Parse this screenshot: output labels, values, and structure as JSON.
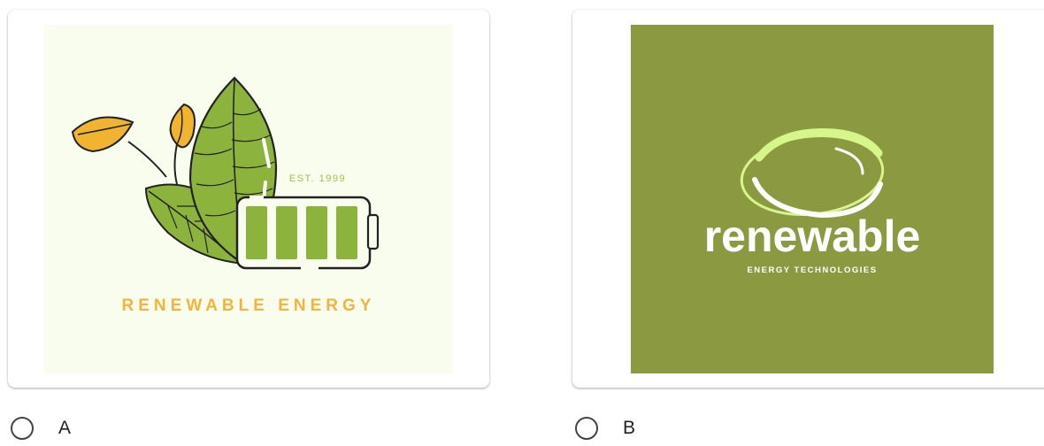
{
  "options": [
    {
      "label": "A",
      "logo": {
        "est_text": "EST. 1999",
        "brand_text": "RENEWABLE ENERGY",
        "colors": {
          "background": "#f8fdee",
          "leaf_green": "#8cb43c",
          "leaf_yellow": "#f0b431",
          "brand": "#f3b33d",
          "battery_cell": "#8cb43c",
          "est": "#9cc24e"
        },
        "battery_level": 1.0
      }
    },
    {
      "label": "B",
      "logo": {
        "brand_text": "renewable",
        "tagline": "ENERGY TECHNOLOGIES",
        "colors": {
          "background": "#8b9a40",
          "ring": "#d6f58a",
          "text": "#ffffff"
        }
      }
    }
  ]
}
